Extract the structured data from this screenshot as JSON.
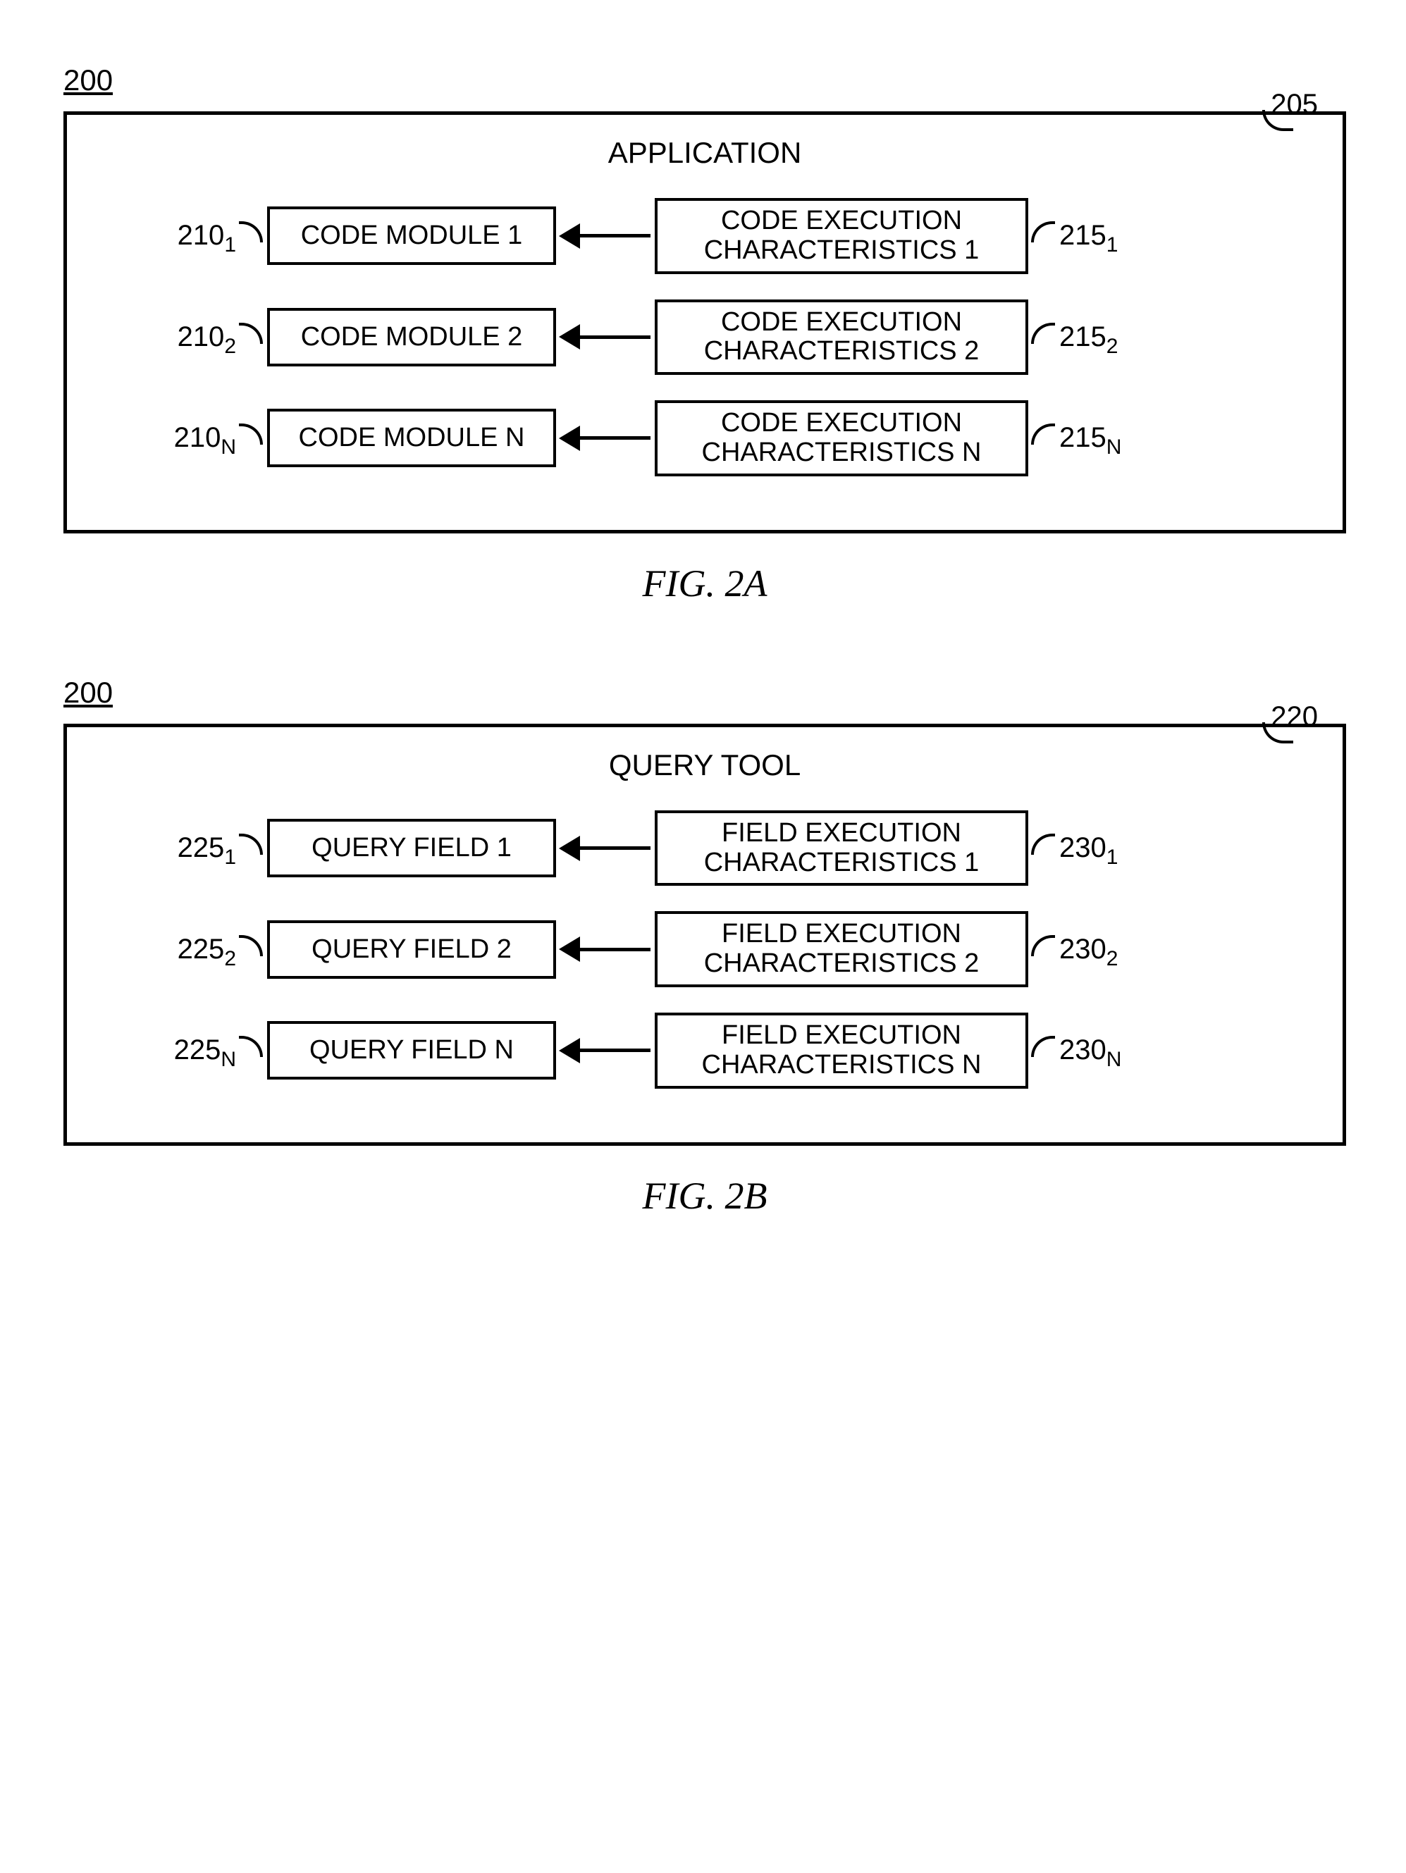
{
  "figA": {
    "figureRef": "200",
    "containerRef": "205",
    "title": "APPLICATION",
    "rows": [
      {
        "leftRef": "210",
        "leftSub": "1",
        "leftBox": "CODE MODULE 1",
        "rightBox": "CODE EXECUTION CHARACTERISTICS 1",
        "rightRef": "215",
        "rightSub": "1"
      },
      {
        "leftRef": "210",
        "leftSub": "2",
        "leftBox": "CODE MODULE 2",
        "rightBox": "CODE EXECUTION CHARACTERISTICS 2",
        "rightRef": "215",
        "rightSub": "2"
      },
      {
        "leftRef": "210",
        "leftSub": "N",
        "leftBox": "CODE MODULE N",
        "rightBox": "CODE EXECUTION CHARACTERISTICS N",
        "rightRef": "215",
        "rightSub": "N"
      }
    ],
    "caption": "FIG. 2A"
  },
  "figB": {
    "figureRef": "200",
    "containerRef": "220",
    "title": "QUERY TOOL",
    "rows": [
      {
        "leftRef": "225",
        "leftSub": "1",
        "leftBox": "QUERY FIELD 1",
        "rightBox": "FIELD EXECUTION CHARACTERISTICS 1",
        "rightRef": "230",
        "rightSub": "1"
      },
      {
        "leftRef": "225",
        "leftSub": "2",
        "leftBox": "QUERY FIELD 2",
        "rightBox": "FIELD EXECUTION CHARACTERISTICS 2",
        "rightRef": "230",
        "rightSub": "2"
      },
      {
        "leftRef": "225",
        "leftSub": "N",
        "leftBox": "QUERY FIELD N",
        "rightBox": "FIELD EXECUTION CHARACTERISTICS N",
        "rightRef": "230",
        "rightSub": "N"
      }
    ],
    "caption": "FIG. 2B"
  }
}
